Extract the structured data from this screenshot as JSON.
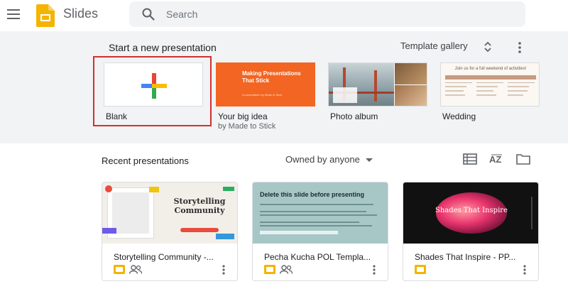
{
  "header": {
    "app_title": "Slides",
    "search_placeholder": "Search",
    "logo_color": "#f4b400"
  },
  "templates": {
    "section_title": "Start a new presentation",
    "gallery_label": "Template gallery",
    "items": [
      {
        "name": "Blank",
        "subtitle": ""
      },
      {
        "name": "Your big idea",
        "subtitle": "by Made to Stick",
        "thumb_title": "Making Presentations That Stick",
        "thumb_sub": "A presentation by Made to Stick"
      },
      {
        "name": "Photo album",
        "subtitle": ""
      },
      {
        "name": "Wedding",
        "subtitle": "",
        "thumb_title": "Join us for a full weekend of activities!"
      }
    ]
  },
  "recent": {
    "section_title": "Recent presentations",
    "owner_filter": "Owned by anyone",
    "view_icons": [
      "list-view-icon",
      "sort-az-icon",
      "folder-icon"
    ],
    "files": [
      {
        "title": "Storytelling Community -...",
        "thumb_text": "Storytelling Community",
        "shared": true
      },
      {
        "title": "Pecha Kucha POL Templa...",
        "thumb_text": "Delete this slide before presenting",
        "shared": true
      },
      {
        "title": "Shades That Inspire - PP...",
        "thumb_text": "Shades That Inspire",
        "shared": false
      }
    ]
  },
  "colors": {
    "accent_highlight": "#d32f2f",
    "slides_yellow": "#f4b400",
    "orange_template": "#f26522",
    "pecha_bg": "#a7c7c6",
    "shades_bg": "#111111"
  }
}
